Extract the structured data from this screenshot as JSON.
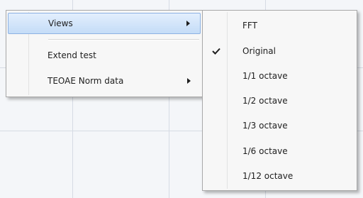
{
  "context_menu": {
    "items": [
      {
        "label": "Views",
        "submenu": true,
        "highlighted": true
      },
      {
        "label": "Extend test",
        "submenu": false
      },
      {
        "label": "TEOAE Norm data",
        "submenu": true
      }
    ]
  },
  "views_submenu": {
    "items": [
      {
        "label": "FFT",
        "checked": false
      },
      {
        "label": "Original",
        "checked": true
      },
      {
        "label": "1/1 octave",
        "checked": false
      },
      {
        "label": "1/2 octave",
        "checked": false
      },
      {
        "label": "1/3 octave",
        "checked": false
      },
      {
        "label": "1/6 octave",
        "checked": false
      },
      {
        "label": "1/12 octave",
        "checked": false
      }
    ]
  },
  "colors": {
    "highlight_border": "#8db2e3",
    "highlight_fill": "#c4dcf7",
    "grid_line": "#d6dbe4",
    "background": "#f4f6f9"
  }
}
